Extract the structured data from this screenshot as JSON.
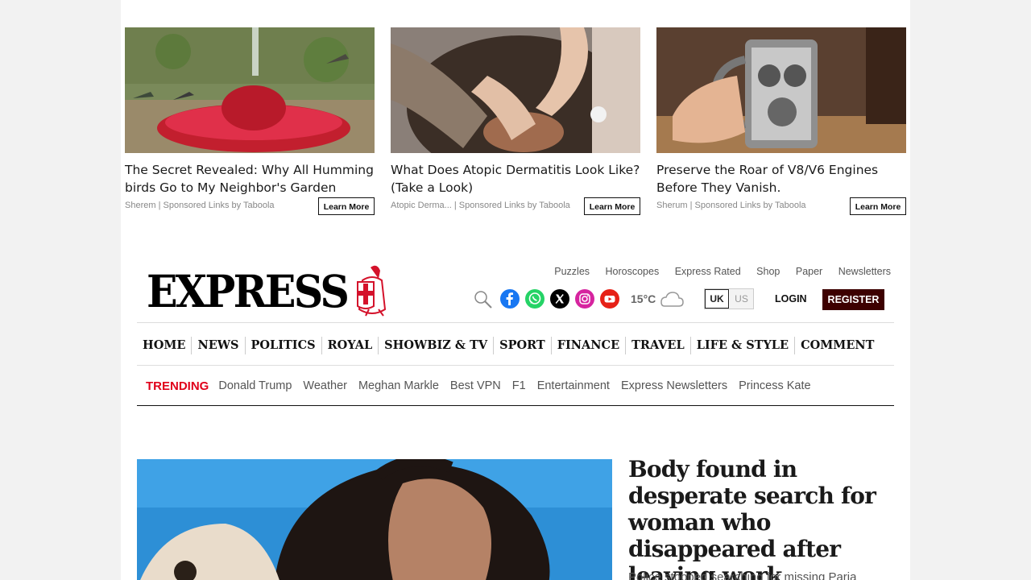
{
  "sponsored": [
    {
      "title": "The Secret Revealed: Why All Hummingbirds Go to My Neighbor's Garden",
      "brand": "Sherem",
      "source": "Sponsored Links by Taboola",
      "cta": "Learn More",
      "image": "hummingbird-feeder-image"
    },
    {
      "title": "What Does Atopic Dermatitis Look Like? (Take a Look)",
      "brand": "Atopic Derma...",
      "source": "Sponsored Links by Taboola",
      "cta": "Learn More",
      "image": "scalp-image"
    },
    {
      "title": "Preserve the Roar of V8/V6 Engines Before They Vanish.",
      "brand": "Sherum",
      "source": "Sponsored Links by Taboola",
      "cta": "Learn More",
      "image": "engine-mug-image"
    }
  ],
  "header": {
    "logo": "EXPRESS",
    "top_links": [
      "Puzzles",
      "Horoscopes",
      "Express Rated",
      "Shop",
      "Paper",
      "Newsletters"
    ],
    "temperature": "15°C",
    "region": {
      "uk": "UK",
      "us": "US"
    },
    "login": "LOGIN",
    "register": "REGISTER",
    "social_icons": [
      "facebook-icon",
      "whatsapp-icon",
      "x-icon",
      "instagram-icon",
      "youtube-icon"
    ],
    "colors": {
      "register_bg": "#3d0000",
      "trending": "#e0001a"
    }
  },
  "nav": [
    "HOME",
    "NEWS",
    "POLITICS",
    "ROYAL",
    "SHOWBIZ & TV",
    "SPORT",
    "FINANCE",
    "TRAVEL",
    "LIFE & STYLE",
    "COMMENT"
  ],
  "trending": {
    "label": "TRENDING",
    "items": [
      "Donald Trump",
      "Weather",
      "Meghan Markle",
      "Best VPN",
      "F1",
      "Entertainment",
      "Express Newsletters",
      "Princess Kate"
    ]
  },
  "lead": {
    "headline": "Body found in desperate search for woman who disappeared after leaving work",
    "standfirst": "Police stopped searching for missing Paria"
  }
}
